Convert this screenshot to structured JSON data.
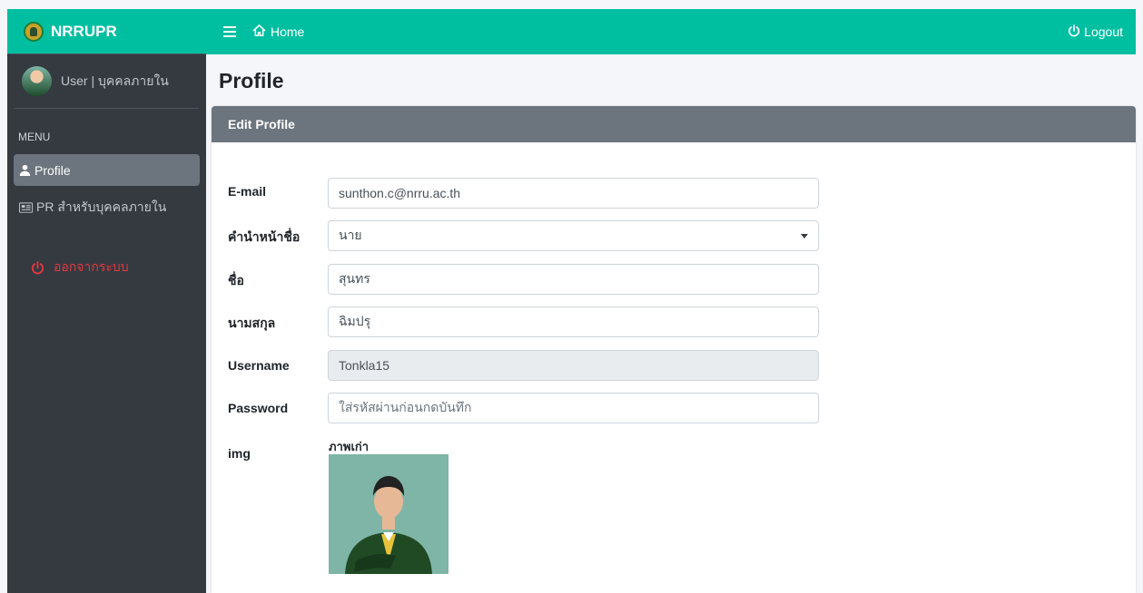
{
  "brand": {
    "name": "NRRUPR"
  },
  "user": {
    "label": "User | บุคคลภายใน"
  },
  "sidebar": {
    "menu_header": "MENU",
    "items": [
      {
        "label": "Profile",
        "icon": "user-icon",
        "active": true
      },
      {
        "label": "PR สำหรับบุคคลภายใน",
        "icon": "newspaper-icon",
        "active": false
      }
    ],
    "logout_label": "ออกจากระบบ"
  },
  "topnav": {
    "home_label": "Home",
    "logout_label": "Logout"
  },
  "page": {
    "title": "Profile"
  },
  "form": {
    "header": "Edit Profile",
    "email": {
      "label": "E-mail",
      "value": "sunthon.c@nrru.ac.th"
    },
    "title": {
      "label": "คำนำหน้าชื่อ",
      "value": "นาย"
    },
    "firstname": {
      "label": "ชื่อ",
      "value": "สุนทร"
    },
    "lastname": {
      "label": "นามสกุล",
      "value": "ฉิมปรุ"
    },
    "username": {
      "label": "Username",
      "value": "Tonkla15"
    },
    "password": {
      "label": "Password",
      "placeholder": "ใส่รหัสผ่านก่อนกดบันทึก"
    },
    "img": {
      "label": "img",
      "caption": "ภาพเก่า"
    }
  },
  "colors": {
    "accent": "#00bfa0",
    "sidebar": "#343a40",
    "card_header": "#6c757d",
    "logout": "#e8363f"
  }
}
